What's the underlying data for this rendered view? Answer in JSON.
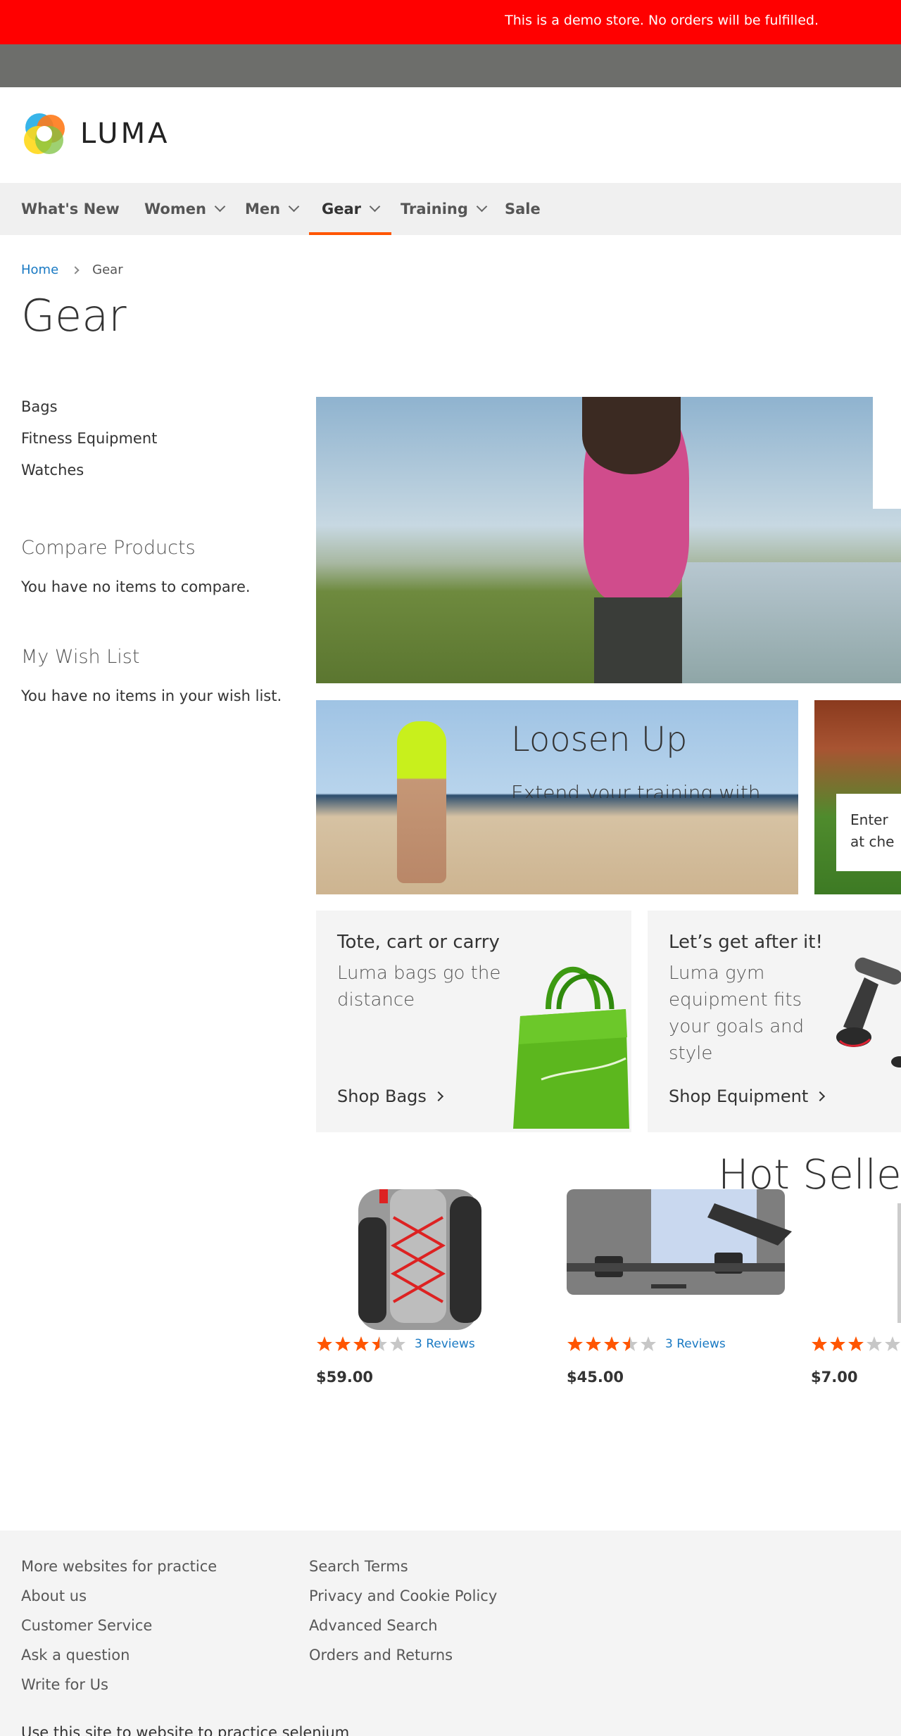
{
  "demo_notice": "This is a demo store. No orders will be fulfilled.",
  "logo": {
    "text": "LUMA"
  },
  "nav": {
    "items": [
      {
        "label": "What's New"
      },
      {
        "label": "Women"
      },
      {
        "label": "Men"
      },
      {
        "label": "Gear"
      },
      {
        "label": "Training"
      },
      {
        "label": "Sale"
      }
    ],
    "active": "Gear"
  },
  "breadcrumb": {
    "home": "Home",
    "current": "Gear"
  },
  "page_title": "Gear",
  "sidebar": {
    "categories": [
      "Bags",
      "Fitness Equipment",
      "Watches"
    ],
    "compare_title": "Compare Products",
    "compare_text": "You have no items to compare.",
    "wishlist_title": "My Wish List",
    "wishlist_text": "You have no items in your wish list."
  },
  "promos": {
    "loosen_title": "Loosen Up",
    "loosen_text": "Extend your training with",
    "second_text_line1": "Enter",
    "second_text_line2": "at che"
  },
  "tiles": {
    "bags": {
      "title": "Tote, cart or carry",
      "text": "Luma bags go the distance",
      "link": "Shop Bags"
    },
    "equipment": {
      "title": "Let’s get after it!",
      "text": "Luma gym equipment fits your goals and style",
      "link": "Shop Equipment"
    }
  },
  "hot_sellers_title": "Hot Sellers",
  "products": [
    {
      "price": "$59.00",
      "reviews": "3 Reviews",
      "rating": 3.5
    },
    {
      "price": "$45.00",
      "reviews": "3 Reviews",
      "rating": 3.5
    },
    {
      "price": "$7.00",
      "reviews": "",
      "rating": 3
    }
  ],
  "colors": {
    "accent": "#ff5501",
    "link": "#1979c3",
    "demo_bar": "#ff0000",
    "star_filled": "#ff5501",
    "star_empty": "#c7c7c7"
  },
  "footer": {
    "col1": [
      "More websites for practice",
      "About us",
      "Customer Service",
      "Ask a question",
      "Write for Us"
    ],
    "col2": [
      "Search Terms",
      "Privacy and Cookie Policy",
      "Advanced Search",
      "Orders and Returns"
    ],
    "bottom_text": "Use this site to website to practice selenium"
  }
}
